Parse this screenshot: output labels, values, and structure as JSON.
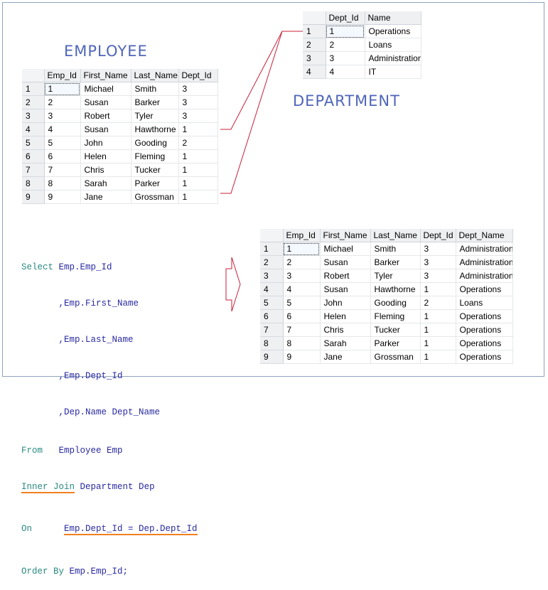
{
  "employee": {
    "title": "EMPLOYEE",
    "columns": [
      "Emp_Id",
      "First_Name",
      "Last_Name",
      "Dept_Id"
    ],
    "rows": [
      [
        "1",
        "Michael",
        "Smith",
        "3"
      ],
      [
        "2",
        "Susan",
        "Barker",
        "3"
      ],
      [
        "3",
        "Robert",
        "Tyler",
        "3"
      ],
      [
        "4",
        "Susan",
        "Hawthorne",
        "1"
      ],
      [
        "5",
        "John",
        "Gooding",
        "2"
      ],
      [
        "6",
        "Helen",
        "Fleming",
        "1"
      ],
      [
        "7",
        "Chris",
        "Tucker",
        "1"
      ],
      [
        "8",
        "Sarah",
        "Parker",
        "1"
      ],
      [
        "9",
        "Jane",
        "Grossman",
        "1"
      ]
    ]
  },
  "department": {
    "title": "DEPARTMENT",
    "columns": [
      "Dept_Id",
      "Name"
    ],
    "rows": [
      [
        "1",
        "Operations"
      ],
      [
        "2",
        "Loans"
      ],
      [
        "3",
        "Administration"
      ],
      [
        "4",
        "IT"
      ]
    ]
  },
  "result": {
    "columns": [
      "Emp_Id",
      "First_Name",
      "Last_Name",
      "Dept_Id",
      "Dept_Name"
    ],
    "rows": [
      [
        "1",
        "Michael",
        "Smith",
        "3",
        "Administration"
      ],
      [
        "2",
        "Susan",
        "Barker",
        "3",
        "Administration"
      ],
      [
        "3",
        "Robert",
        "Tyler",
        "3",
        "Administration"
      ],
      [
        "4",
        "Susan",
        "Hawthorne",
        "1",
        "Operations"
      ],
      [
        "5",
        "John",
        "Gooding",
        "2",
        "Loans"
      ],
      [
        "6",
        "Helen",
        "Fleming",
        "1",
        "Operations"
      ],
      [
        "7",
        "Chris",
        "Tucker",
        "1",
        "Operations"
      ],
      [
        "8",
        "Sarah",
        "Parker",
        "1",
        "Operations"
      ],
      [
        "9",
        "Jane",
        "Grossman",
        "1",
        "Operations"
      ]
    ]
  },
  "sql": {
    "select_kw": "Select",
    "select_first": " Emp.Emp_Id",
    "select_rest": [
      "       ,Emp.First_Name",
      "       ,Emp.Last_Name",
      "       ,Emp.Dept_Id",
      "       ,Dep.Name Dept_Name"
    ],
    "from_kw": "From",
    "from_rest": "   Employee Emp",
    "inner_kw": "Inner",
    "join_kw": "Join",
    "join_rest": " Department Dep",
    "on_kw": "On",
    "on_rest": "Emp.Dept_Id = Dep.Dept_Id",
    "order_kw": "Order",
    "by_kw": "By",
    "order_rest": " Emp.Emp_Id;"
  },
  "colors": {
    "heading": "#4f66b8",
    "keyword": "#2a8a80",
    "identifier": "#2a2aa0",
    "underline": "#f08020",
    "connector": "#c8203a"
  }
}
